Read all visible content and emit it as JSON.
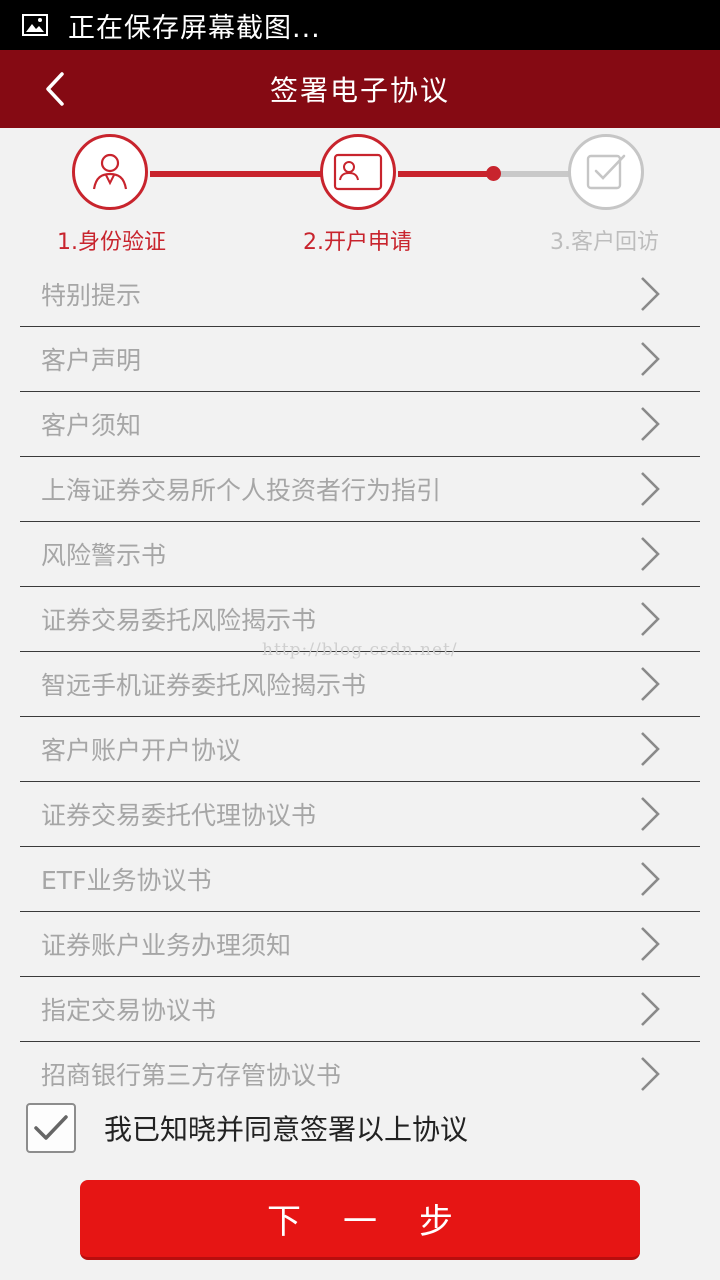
{
  "status_bar": {
    "text": "正在保存屏幕截图...",
    "icon": "image-icon"
  },
  "nav": {
    "title": "签署电子协议",
    "back_icon": "chevron-left-icon"
  },
  "steps": [
    {
      "label": "1.身份验证",
      "icon": "user-icon",
      "state": "done"
    },
    {
      "label": "2.开户申请",
      "icon": "id-card-icon",
      "state": "active"
    },
    {
      "label": "3.客户回访",
      "icon": "checklist-icon",
      "state": "inactive"
    }
  ],
  "documents": [
    "特别提示",
    "客户声明",
    "客户须知",
    "上海证券交易所个人投资者行为指引",
    "风险警示书",
    "证券交易委托风险揭示书",
    "智远手机证券委托风险揭示书",
    "客户账户开户协议",
    "证券交易委托代理协议书",
    "ETF业务协议书",
    "证券账户业务办理须知",
    "指定交易协议书",
    "招商银行第三方存管协议书"
  ],
  "watermark": "http://blog.csdn.net/",
  "agreement": {
    "text": "我已知晓并同意签署以上协议",
    "checked": true
  },
  "next_button": "下一步",
  "colors": {
    "brand_dark": "#850a13",
    "accent": "#c8242d",
    "button": "#e61514"
  }
}
